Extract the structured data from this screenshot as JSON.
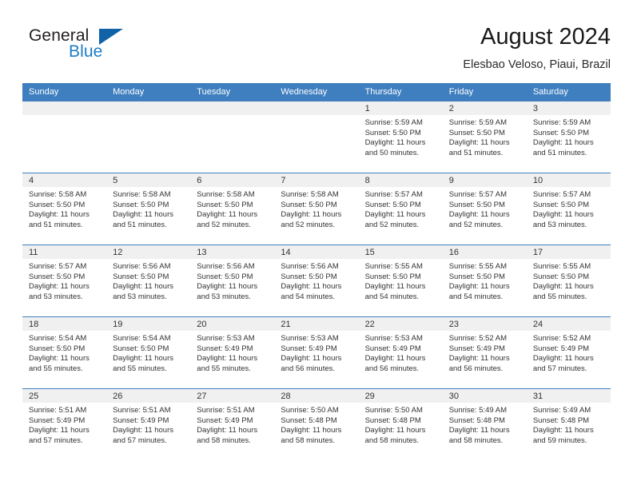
{
  "logo": {
    "word1": "General",
    "word2": "Blue",
    "triangle_color": "#1262a8",
    "blue_color": "#1d7dc4"
  },
  "header": {
    "title": "August 2024",
    "subtitle": "Elesbao Veloso, Piaui, Brazil"
  },
  "colors": {
    "header_blue": "#3f7fbf",
    "daynum_band": "#f0f0f0",
    "text": "#333333"
  },
  "calendar": {
    "day_headers": [
      "Sunday",
      "Monday",
      "Tuesday",
      "Wednesday",
      "Thursday",
      "Friday",
      "Saturday"
    ],
    "weeks": [
      [
        {
          "day": "",
          "lines": []
        },
        {
          "day": "",
          "lines": []
        },
        {
          "day": "",
          "lines": []
        },
        {
          "day": "",
          "lines": []
        },
        {
          "day": "1",
          "lines": [
            "Sunrise: 5:59 AM",
            "Sunset: 5:50 PM",
            "Daylight: 11 hours",
            "and 50 minutes."
          ]
        },
        {
          "day": "2",
          "lines": [
            "Sunrise: 5:59 AM",
            "Sunset: 5:50 PM",
            "Daylight: 11 hours",
            "and 51 minutes."
          ]
        },
        {
          "day": "3",
          "lines": [
            "Sunrise: 5:59 AM",
            "Sunset: 5:50 PM",
            "Daylight: 11 hours",
            "and 51 minutes."
          ]
        }
      ],
      [
        {
          "day": "4",
          "lines": [
            "Sunrise: 5:58 AM",
            "Sunset: 5:50 PM",
            "Daylight: 11 hours",
            "and 51 minutes."
          ]
        },
        {
          "day": "5",
          "lines": [
            "Sunrise: 5:58 AM",
            "Sunset: 5:50 PM",
            "Daylight: 11 hours",
            "and 51 minutes."
          ]
        },
        {
          "day": "6",
          "lines": [
            "Sunrise: 5:58 AM",
            "Sunset: 5:50 PM",
            "Daylight: 11 hours",
            "and 52 minutes."
          ]
        },
        {
          "day": "7",
          "lines": [
            "Sunrise: 5:58 AM",
            "Sunset: 5:50 PM",
            "Daylight: 11 hours",
            "and 52 minutes."
          ]
        },
        {
          "day": "8",
          "lines": [
            "Sunrise: 5:57 AM",
            "Sunset: 5:50 PM",
            "Daylight: 11 hours",
            "and 52 minutes."
          ]
        },
        {
          "day": "9",
          "lines": [
            "Sunrise: 5:57 AM",
            "Sunset: 5:50 PM",
            "Daylight: 11 hours",
            "and 52 minutes."
          ]
        },
        {
          "day": "10",
          "lines": [
            "Sunrise: 5:57 AM",
            "Sunset: 5:50 PM",
            "Daylight: 11 hours",
            "and 53 minutes."
          ]
        }
      ],
      [
        {
          "day": "11",
          "lines": [
            "Sunrise: 5:57 AM",
            "Sunset: 5:50 PM",
            "Daylight: 11 hours",
            "and 53 minutes."
          ]
        },
        {
          "day": "12",
          "lines": [
            "Sunrise: 5:56 AM",
            "Sunset: 5:50 PM",
            "Daylight: 11 hours",
            "and 53 minutes."
          ]
        },
        {
          "day": "13",
          "lines": [
            "Sunrise: 5:56 AM",
            "Sunset: 5:50 PM",
            "Daylight: 11 hours",
            "and 53 minutes."
          ]
        },
        {
          "day": "14",
          "lines": [
            "Sunrise: 5:56 AM",
            "Sunset: 5:50 PM",
            "Daylight: 11 hours",
            "and 54 minutes."
          ]
        },
        {
          "day": "15",
          "lines": [
            "Sunrise: 5:55 AM",
            "Sunset: 5:50 PM",
            "Daylight: 11 hours",
            "and 54 minutes."
          ]
        },
        {
          "day": "16",
          "lines": [
            "Sunrise: 5:55 AM",
            "Sunset: 5:50 PM",
            "Daylight: 11 hours",
            "and 54 minutes."
          ]
        },
        {
          "day": "17",
          "lines": [
            "Sunrise: 5:55 AM",
            "Sunset: 5:50 PM",
            "Daylight: 11 hours",
            "and 55 minutes."
          ]
        }
      ],
      [
        {
          "day": "18",
          "lines": [
            "Sunrise: 5:54 AM",
            "Sunset: 5:50 PM",
            "Daylight: 11 hours",
            "and 55 minutes."
          ]
        },
        {
          "day": "19",
          "lines": [
            "Sunrise: 5:54 AM",
            "Sunset: 5:50 PM",
            "Daylight: 11 hours",
            "and 55 minutes."
          ]
        },
        {
          "day": "20",
          "lines": [
            "Sunrise: 5:53 AM",
            "Sunset: 5:49 PM",
            "Daylight: 11 hours",
            "and 55 minutes."
          ]
        },
        {
          "day": "21",
          "lines": [
            "Sunrise: 5:53 AM",
            "Sunset: 5:49 PM",
            "Daylight: 11 hours",
            "and 56 minutes."
          ]
        },
        {
          "day": "22",
          "lines": [
            "Sunrise: 5:53 AM",
            "Sunset: 5:49 PM",
            "Daylight: 11 hours",
            "and 56 minutes."
          ]
        },
        {
          "day": "23",
          "lines": [
            "Sunrise: 5:52 AM",
            "Sunset: 5:49 PM",
            "Daylight: 11 hours",
            "and 56 minutes."
          ]
        },
        {
          "day": "24",
          "lines": [
            "Sunrise: 5:52 AM",
            "Sunset: 5:49 PM",
            "Daylight: 11 hours",
            "and 57 minutes."
          ]
        }
      ],
      [
        {
          "day": "25",
          "lines": [
            "Sunrise: 5:51 AM",
            "Sunset: 5:49 PM",
            "Daylight: 11 hours",
            "and 57 minutes."
          ]
        },
        {
          "day": "26",
          "lines": [
            "Sunrise: 5:51 AM",
            "Sunset: 5:49 PM",
            "Daylight: 11 hours",
            "and 57 minutes."
          ]
        },
        {
          "day": "27",
          "lines": [
            "Sunrise: 5:51 AM",
            "Sunset: 5:49 PM",
            "Daylight: 11 hours",
            "and 58 minutes."
          ]
        },
        {
          "day": "28",
          "lines": [
            "Sunrise: 5:50 AM",
            "Sunset: 5:48 PM",
            "Daylight: 11 hours",
            "and 58 minutes."
          ]
        },
        {
          "day": "29",
          "lines": [
            "Sunrise: 5:50 AM",
            "Sunset: 5:48 PM",
            "Daylight: 11 hours",
            "and 58 minutes."
          ]
        },
        {
          "day": "30",
          "lines": [
            "Sunrise: 5:49 AM",
            "Sunset: 5:48 PM",
            "Daylight: 11 hours",
            "and 58 minutes."
          ]
        },
        {
          "day": "31",
          "lines": [
            "Sunrise: 5:49 AM",
            "Sunset: 5:48 PM",
            "Daylight: 11 hours",
            "and 59 minutes."
          ]
        }
      ]
    ]
  }
}
